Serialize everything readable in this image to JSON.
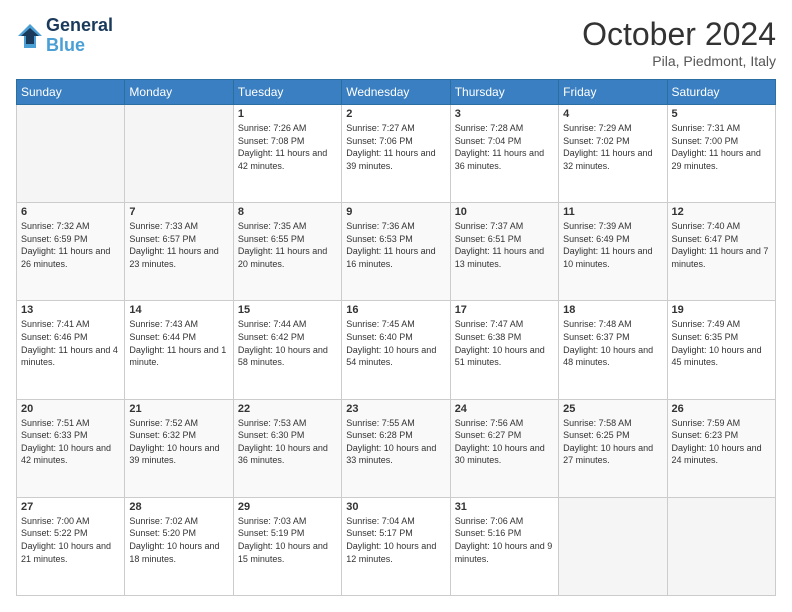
{
  "header": {
    "logo_line1": "General",
    "logo_line2": "Blue",
    "month": "October 2024",
    "location": "Pila, Piedmont, Italy"
  },
  "weekdays": [
    "Sunday",
    "Monday",
    "Tuesday",
    "Wednesday",
    "Thursday",
    "Friday",
    "Saturday"
  ],
  "weeks": [
    [
      {
        "day": "",
        "info": ""
      },
      {
        "day": "",
        "info": ""
      },
      {
        "day": "1",
        "info": "Sunrise: 7:26 AM\nSunset: 7:08 PM\nDaylight: 11 hours and 42 minutes."
      },
      {
        "day": "2",
        "info": "Sunrise: 7:27 AM\nSunset: 7:06 PM\nDaylight: 11 hours and 39 minutes."
      },
      {
        "day": "3",
        "info": "Sunrise: 7:28 AM\nSunset: 7:04 PM\nDaylight: 11 hours and 36 minutes."
      },
      {
        "day": "4",
        "info": "Sunrise: 7:29 AM\nSunset: 7:02 PM\nDaylight: 11 hours and 32 minutes."
      },
      {
        "day": "5",
        "info": "Sunrise: 7:31 AM\nSunset: 7:00 PM\nDaylight: 11 hours and 29 minutes."
      }
    ],
    [
      {
        "day": "6",
        "info": "Sunrise: 7:32 AM\nSunset: 6:59 PM\nDaylight: 11 hours and 26 minutes."
      },
      {
        "day": "7",
        "info": "Sunrise: 7:33 AM\nSunset: 6:57 PM\nDaylight: 11 hours and 23 minutes."
      },
      {
        "day": "8",
        "info": "Sunrise: 7:35 AM\nSunset: 6:55 PM\nDaylight: 11 hours and 20 minutes."
      },
      {
        "day": "9",
        "info": "Sunrise: 7:36 AM\nSunset: 6:53 PM\nDaylight: 11 hours and 16 minutes."
      },
      {
        "day": "10",
        "info": "Sunrise: 7:37 AM\nSunset: 6:51 PM\nDaylight: 11 hours and 13 minutes."
      },
      {
        "day": "11",
        "info": "Sunrise: 7:39 AM\nSunset: 6:49 PM\nDaylight: 11 hours and 10 minutes."
      },
      {
        "day": "12",
        "info": "Sunrise: 7:40 AM\nSunset: 6:47 PM\nDaylight: 11 hours and 7 minutes."
      }
    ],
    [
      {
        "day": "13",
        "info": "Sunrise: 7:41 AM\nSunset: 6:46 PM\nDaylight: 11 hours and 4 minutes."
      },
      {
        "day": "14",
        "info": "Sunrise: 7:43 AM\nSunset: 6:44 PM\nDaylight: 11 hours and 1 minute."
      },
      {
        "day": "15",
        "info": "Sunrise: 7:44 AM\nSunset: 6:42 PM\nDaylight: 10 hours and 58 minutes."
      },
      {
        "day": "16",
        "info": "Sunrise: 7:45 AM\nSunset: 6:40 PM\nDaylight: 10 hours and 54 minutes."
      },
      {
        "day": "17",
        "info": "Sunrise: 7:47 AM\nSunset: 6:38 PM\nDaylight: 10 hours and 51 minutes."
      },
      {
        "day": "18",
        "info": "Sunrise: 7:48 AM\nSunset: 6:37 PM\nDaylight: 10 hours and 48 minutes."
      },
      {
        "day": "19",
        "info": "Sunrise: 7:49 AM\nSunset: 6:35 PM\nDaylight: 10 hours and 45 minutes."
      }
    ],
    [
      {
        "day": "20",
        "info": "Sunrise: 7:51 AM\nSunset: 6:33 PM\nDaylight: 10 hours and 42 minutes."
      },
      {
        "day": "21",
        "info": "Sunrise: 7:52 AM\nSunset: 6:32 PM\nDaylight: 10 hours and 39 minutes."
      },
      {
        "day": "22",
        "info": "Sunrise: 7:53 AM\nSunset: 6:30 PM\nDaylight: 10 hours and 36 minutes."
      },
      {
        "day": "23",
        "info": "Sunrise: 7:55 AM\nSunset: 6:28 PM\nDaylight: 10 hours and 33 minutes."
      },
      {
        "day": "24",
        "info": "Sunrise: 7:56 AM\nSunset: 6:27 PM\nDaylight: 10 hours and 30 minutes."
      },
      {
        "day": "25",
        "info": "Sunrise: 7:58 AM\nSunset: 6:25 PM\nDaylight: 10 hours and 27 minutes."
      },
      {
        "day": "26",
        "info": "Sunrise: 7:59 AM\nSunset: 6:23 PM\nDaylight: 10 hours and 24 minutes."
      }
    ],
    [
      {
        "day": "27",
        "info": "Sunrise: 7:00 AM\nSunset: 5:22 PM\nDaylight: 10 hours and 21 minutes."
      },
      {
        "day": "28",
        "info": "Sunrise: 7:02 AM\nSunset: 5:20 PM\nDaylight: 10 hours and 18 minutes."
      },
      {
        "day": "29",
        "info": "Sunrise: 7:03 AM\nSunset: 5:19 PM\nDaylight: 10 hours and 15 minutes."
      },
      {
        "day": "30",
        "info": "Sunrise: 7:04 AM\nSunset: 5:17 PM\nDaylight: 10 hours and 12 minutes."
      },
      {
        "day": "31",
        "info": "Sunrise: 7:06 AM\nSunset: 5:16 PM\nDaylight: 10 hours and 9 minutes."
      },
      {
        "day": "",
        "info": ""
      },
      {
        "day": "",
        "info": ""
      }
    ]
  ]
}
